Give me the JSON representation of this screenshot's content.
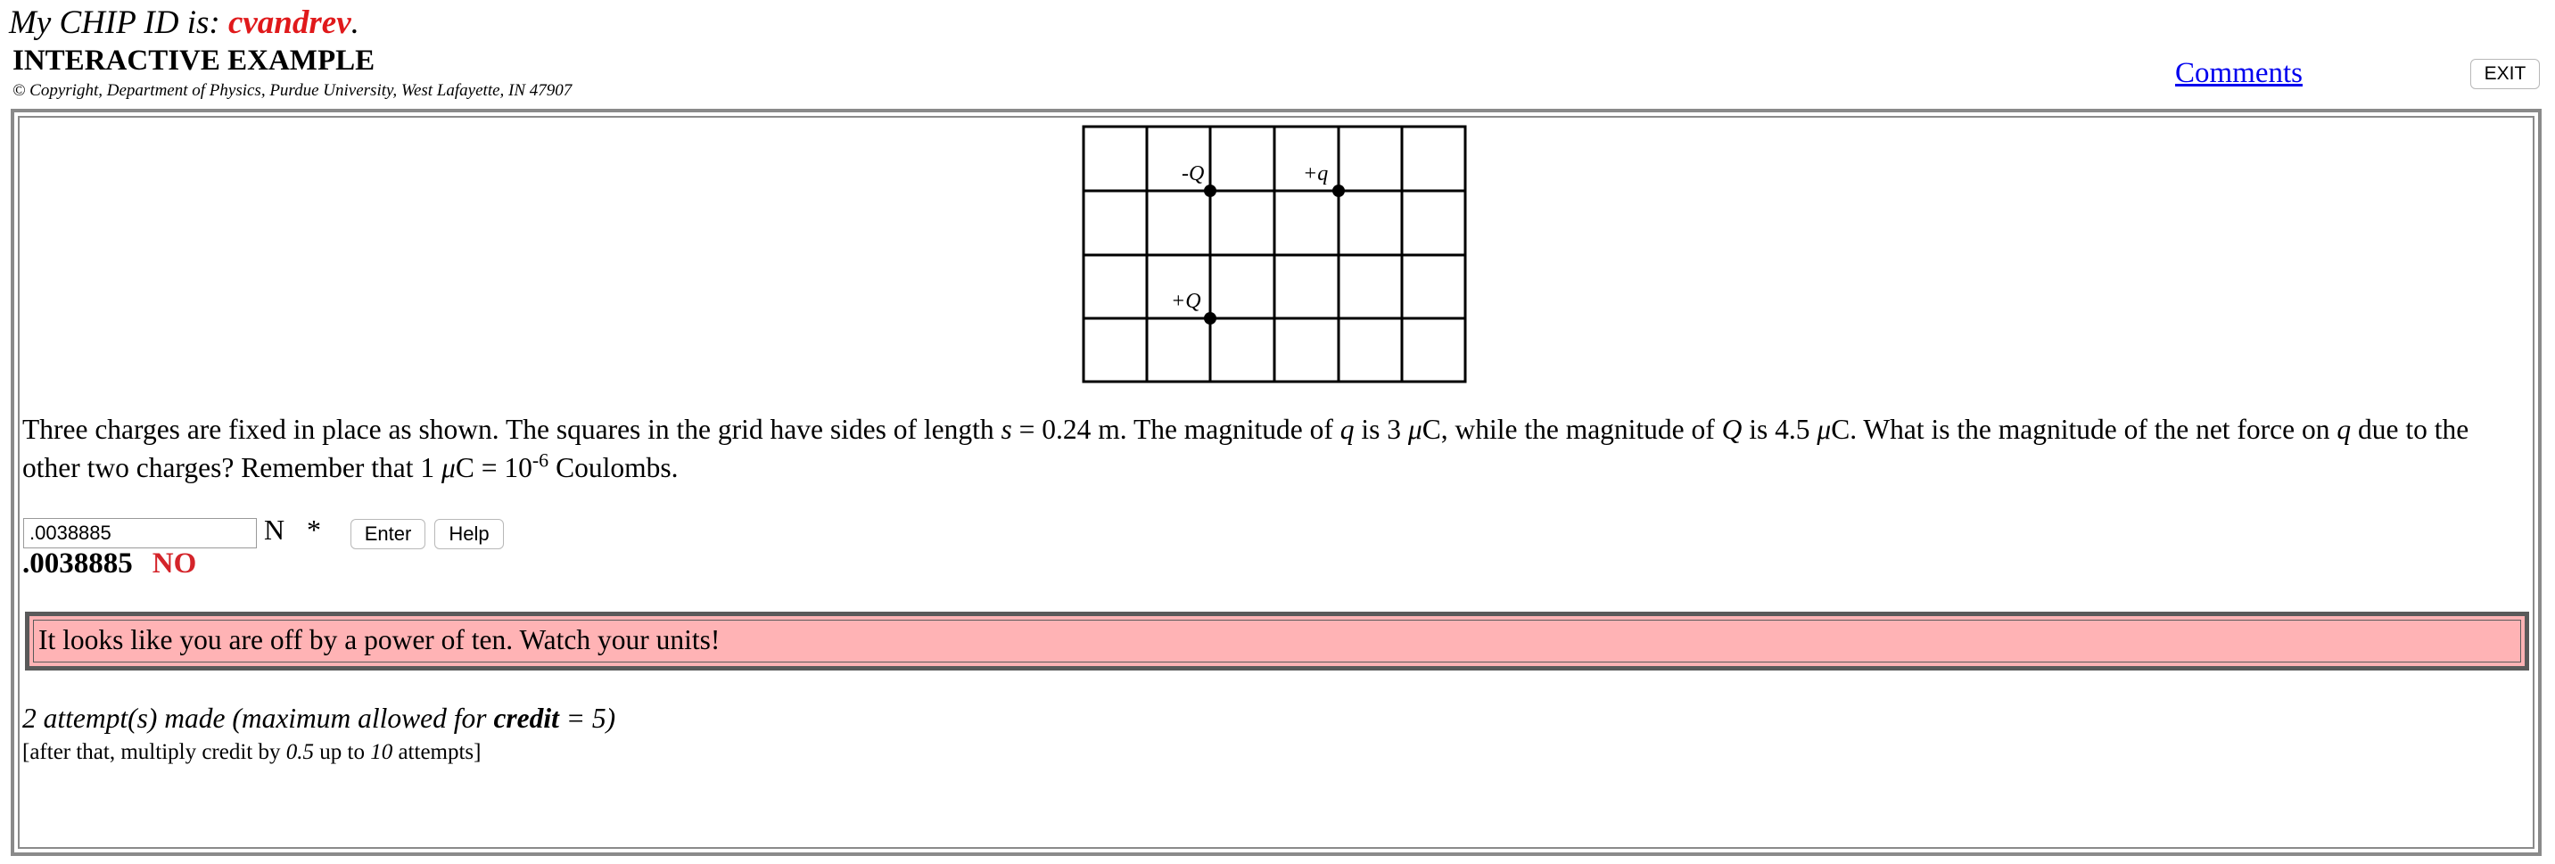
{
  "header": {
    "chip_prefix": "My CHIP ID is: ",
    "chip_id": "cvandrev",
    "chip_suffix": ".",
    "heading": "INTERACTIVE EXAMPLE",
    "copyright": "© Copyright, Department of Physics, Purdue University, West Lafayette, IN 47907",
    "comments_link": "Comments",
    "exit_button": "EXIT"
  },
  "diagram": {
    "labels": {
      "minus_Q": "-Q",
      "plus_q": "+q",
      "plus_Q": "+Q"
    }
  },
  "question": {
    "p1": "Three charges are fixed in place as shown. The squares in the grid have sides of length ",
    "s_var": "s",
    "p2": " = 0.24 m. The magnitude of ",
    "q_var": "q",
    "p3": " is 3 ",
    "mu1": "μ",
    "p4": "C, while the magnitude of ",
    "Q_var": "Q",
    "p5": " is 4.5 ",
    "mu2": "μ",
    "p6": "C. What is the magnitude of the net force on ",
    "q_var2": "q",
    "p7": " due to the other two charges? Remember that 1 ",
    "mu3": "μ",
    "p8": "C = 10",
    "exponent": "-6",
    "p9": " Coulombs."
  },
  "answer": {
    "input_value": ".0038885",
    "unit": "N",
    "asterisk": "*",
    "enter_button": "Enter",
    "help_button": "Help",
    "submitted_value": ".0038885",
    "verdict": "NO"
  },
  "feedback": {
    "message": "It looks like you are off by a power of ten. Watch your units!",
    "background_color": "#ffb3b5"
  },
  "attempts": {
    "prefix": "2 attempt(s) made (maximum allowed for ",
    "credit_word": "credit",
    "suffix": " = 5)",
    "note_a": "[after that, multiply credit by ",
    "factor": "0.5",
    "note_b": " up to ",
    "max_attempts": "10",
    "note_c": " attempts]"
  }
}
